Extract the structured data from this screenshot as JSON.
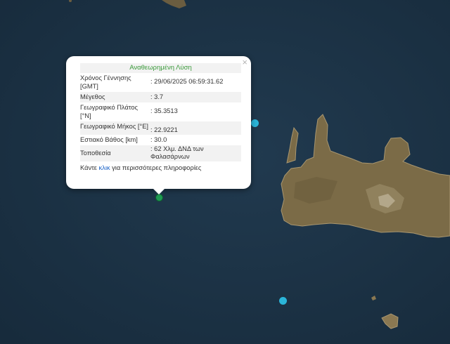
{
  "popup": {
    "title": "Αναθεωρημένη Λύση",
    "close_glyph": "×",
    "rows": [
      {
        "label": "Χρόνος Γέννησης [GMT]",
        "value": ": 29/06/2025 06:59:31.62"
      },
      {
        "label": "Μέγεθος",
        "value": ": 3.7"
      },
      {
        "label": "Γεωγραφικό Πλάτος [°N]",
        "value": ": 35.3513"
      },
      {
        "label": "Γεωγραφικό Μήκος [°E]",
        "value": ": 22.9221"
      },
      {
        "label": "Εστιακό Βάθος [km]",
        "value": ": 30.0"
      },
      {
        "label": "Τοποθεσία",
        "value": ": 62 Χλμ. ΔΝΔ των Φαλασάρνων"
      }
    ],
    "footer_before": "Κάντε ",
    "footer_link": "κλικ",
    "footer_after": " για περισσότερες πληροφορίες"
  },
  "map": {
    "sea_color": "#1c3346",
    "land_color": "#7a6a48",
    "selected_marker_color": "#1f9a52",
    "other_marker_color": "#2bb5d9",
    "close_icon": "close-icon"
  }
}
